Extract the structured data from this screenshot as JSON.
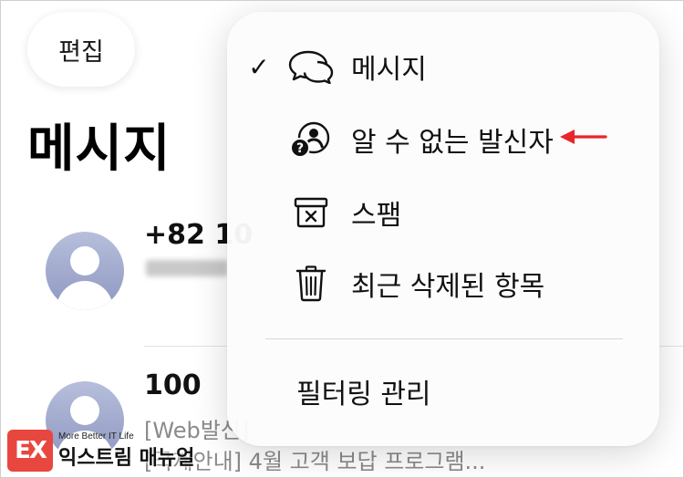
{
  "header": {
    "edit_label": "편집",
    "title": "메시지"
  },
  "conversations": [
    {
      "name": "+82 10",
      "snippet": ""
    },
    {
      "name": "100",
      "snippet": "[Web발신]",
      "snippet2": "[국제안내] 4월 고객 보답 프로그램..."
    }
  ],
  "menu": {
    "items": [
      {
        "label": "메시지",
        "checked": "✓",
        "icon": "chat-bubbles-icon"
      },
      {
        "label": "알 수 없는 발신자",
        "checked": "",
        "icon": "unknown-sender-icon"
      },
      {
        "label": "스팸",
        "checked": "",
        "icon": "spam-bin-icon"
      },
      {
        "label": "최근 삭제된 항목",
        "checked": "",
        "icon": "trash-icon"
      }
    ],
    "manage_label": "필터링 관리"
  },
  "annotation": {
    "arrow_color": "#e8262a"
  },
  "watermark": {
    "logo_text": "EX",
    "sub": "More Better IT Life",
    "main": "익스트림 매뉴얼"
  }
}
